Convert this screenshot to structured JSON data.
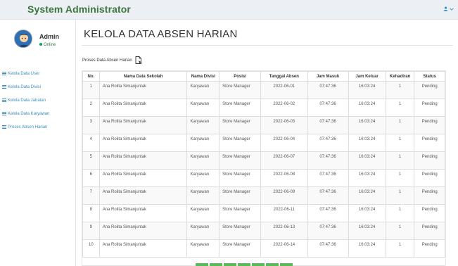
{
  "header": {
    "brand": "System Administrator",
    "user_menu_icon": "user-icon",
    "caret_icon": "caret-down-icon"
  },
  "sidebar": {
    "user_name": "Admin",
    "user_status": "Online",
    "items": [
      {
        "label": "Kelola Data User"
      },
      {
        "label": "Kelola Data Divisi"
      },
      {
        "label": "Kelola Data Jabatan"
      },
      {
        "label": "Kelola Data Karyawan"
      },
      {
        "label": "Proses Absen Harian"
      }
    ]
  },
  "page": {
    "title": "KELOLA DATA ABSEN HARIAN",
    "panel_label": "Proses Data Absen Harian"
  },
  "table": {
    "headers": [
      "No.",
      "Nama Data Sekolah",
      "Nama Divisi",
      "Posisi",
      "Tanggal Absen",
      "Jam Masuk",
      "Jam Keluar",
      "Kehadiran",
      "Status"
    ],
    "rows": [
      {
        "no": "1",
        "name": "Ana Rolita Simanjuntak",
        "divisi": "Karyawan",
        "posisi": "Store Manager",
        "tanggal": "2022-06-01",
        "masuk": "07:47:36",
        "keluar": "16:03:24",
        "kehadiran": "1",
        "status": "Pending"
      },
      {
        "no": "2",
        "name": "Ana Rolita Simanjuntak",
        "divisi": "Karyawan",
        "posisi": "Store Manager",
        "tanggal": "2022-06-02",
        "masuk": "07:47:36",
        "keluar": "16:03:24",
        "kehadiran": "1",
        "status": "Pending"
      },
      {
        "no": "3",
        "name": "Ana Rolita Simanjuntak",
        "divisi": "Karyawan",
        "posisi": "Store Manager",
        "tanggal": "2022-06-03",
        "masuk": "07:47:36",
        "keluar": "16:03:24",
        "kehadiran": "1",
        "status": "Pending"
      },
      {
        "no": "4",
        "name": "Ana Rolita Simanjuntak",
        "divisi": "Karyawan",
        "posisi": "Store Manager",
        "tanggal": "2022-06-04",
        "masuk": "07:47:36",
        "keluar": "16:03:24",
        "kehadiran": "1",
        "status": "Pending"
      },
      {
        "no": "5",
        "name": "Ana Rolita Simanjuntak",
        "divisi": "Karyawan",
        "posisi": "Store Manager",
        "tanggal": "2022-06-07",
        "masuk": "07:47:36",
        "keluar": "16:03:24",
        "kehadiran": "1",
        "status": "Pending"
      },
      {
        "no": "6",
        "name": "Ana Rolita Simanjuntak",
        "divisi": "Karyawan",
        "posisi": "Store Manager",
        "tanggal": "2022-06-08",
        "masuk": "07:47:36",
        "keluar": "16:03:24",
        "kehadiran": "1",
        "status": "Pending"
      },
      {
        "no": "7",
        "name": "Ana Rolita Simanjuntak",
        "divisi": "Karyawan",
        "posisi": "Store Manager",
        "tanggal": "2022-06-09",
        "masuk": "07:47:36",
        "keluar": "16:03:24",
        "kehadiran": "1",
        "status": "Pending"
      },
      {
        "no": "8",
        "name": "Ana Rolita Simanjuntak",
        "divisi": "Karyawan",
        "posisi": "Store Manager",
        "tanggal": "2022-06-11",
        "masuk": "07:47:36",
        "keluar": "16:03:24",
        "kehadiran": "1",
        "status": "Pending"
      },
      {
        "no": "9",
        "name": "Ana Rolita Simanjuntak",
        "divisi": "Karyawan",
        "posisi": "Store Manager",
        "tanggal": "2022-06-13",
        "masuk": "07:47:36",
        "keluar": "16:03:24",
        "kehadiran": "1",
        "status": "Pending"
      },
      {
        "no": "10",
        "name": "Ana Rolita Simanjuntak",
        "divisi": "Karyawan",
        "posisi": "Store Manager",
        "tanggal": "2022-06-14",
        "masuk": "07:47:36",
        "keluar": "16:03:24",
        "kehadiran": "1",
        "status": "Pending"
      }
    ]
  },
  "colors": {
    "brand": "#3c763d",
    "link": "#3c8dbc",
    "online": "#00a65a",
    "pager": "#5cb85c"
  }
}
